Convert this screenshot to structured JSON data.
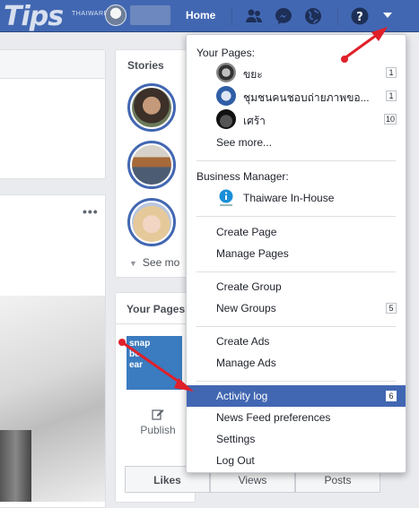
{
  "watermark": {
    "logo": "Tips",
    "brand": "THAIWARE"
  },
  "topbar": {
    "home_label": "Home",
    "icons": [
      "friends-icon",
      "messenger-icon",
      "globe-icon",
      "help-icon",
      "caret-down-icon"
    ]
  },
  "stories": {
    "title": "Stories",
    "see_more": "See mo"
  },
  "your_pages_card": {
    "title": "Your Pages",
    "logo_text": [
      "snap",
      "be",
      "ear"
    ],
    "publish_label": "Publish",
    "tabs": [
      "Likes",
      "Views",
      "Posts"
    ]
  },
  "menu": {
    "your_pages_label": "Your Pages:",
    "pages": [
      {
        "name": "ขยะ",
        "count": "1"
      },
      {
        "name": "ชุมชนคนชอบถ่ายภาพขอ...",
        "count": "1"
      },
      {
        "name": "เศร้า",
        "count": "10"
      }
    ],
    "see_more": "See more...",
    "business_label": "Business Manager:",
    "business_name": "Thaiware In-House",
    "page_items": [
      "Create Page",
      "Manage Pages"
    ],
    "group_items": [
      {
        "label": "Create Group",
        "count": ""
      },
      {
        "label": "New Groups",
        "count": "5"
      }
    ],
    "ads_items": [
      "Create Ads",
      "Manage Ads"
    ],
    "bottom_items": [
      {
        "label": "Activity log",
        "count": "6",
        "active": true
      },
      {
        "label": "News Feed preferences",
        "count": "",
        "active": false
      },
      {
        "label": "Settings",
        "count": "",
        "active": false
      },
      {
        "label": "Log Out",
        "count": "",
        "active": false
      }
    ]
  },
  "colors": {
    "brand": "#4267b2",
    "highlight": "#4267b2",
    "annotation_arrow": "#e0202a"
  }
}
